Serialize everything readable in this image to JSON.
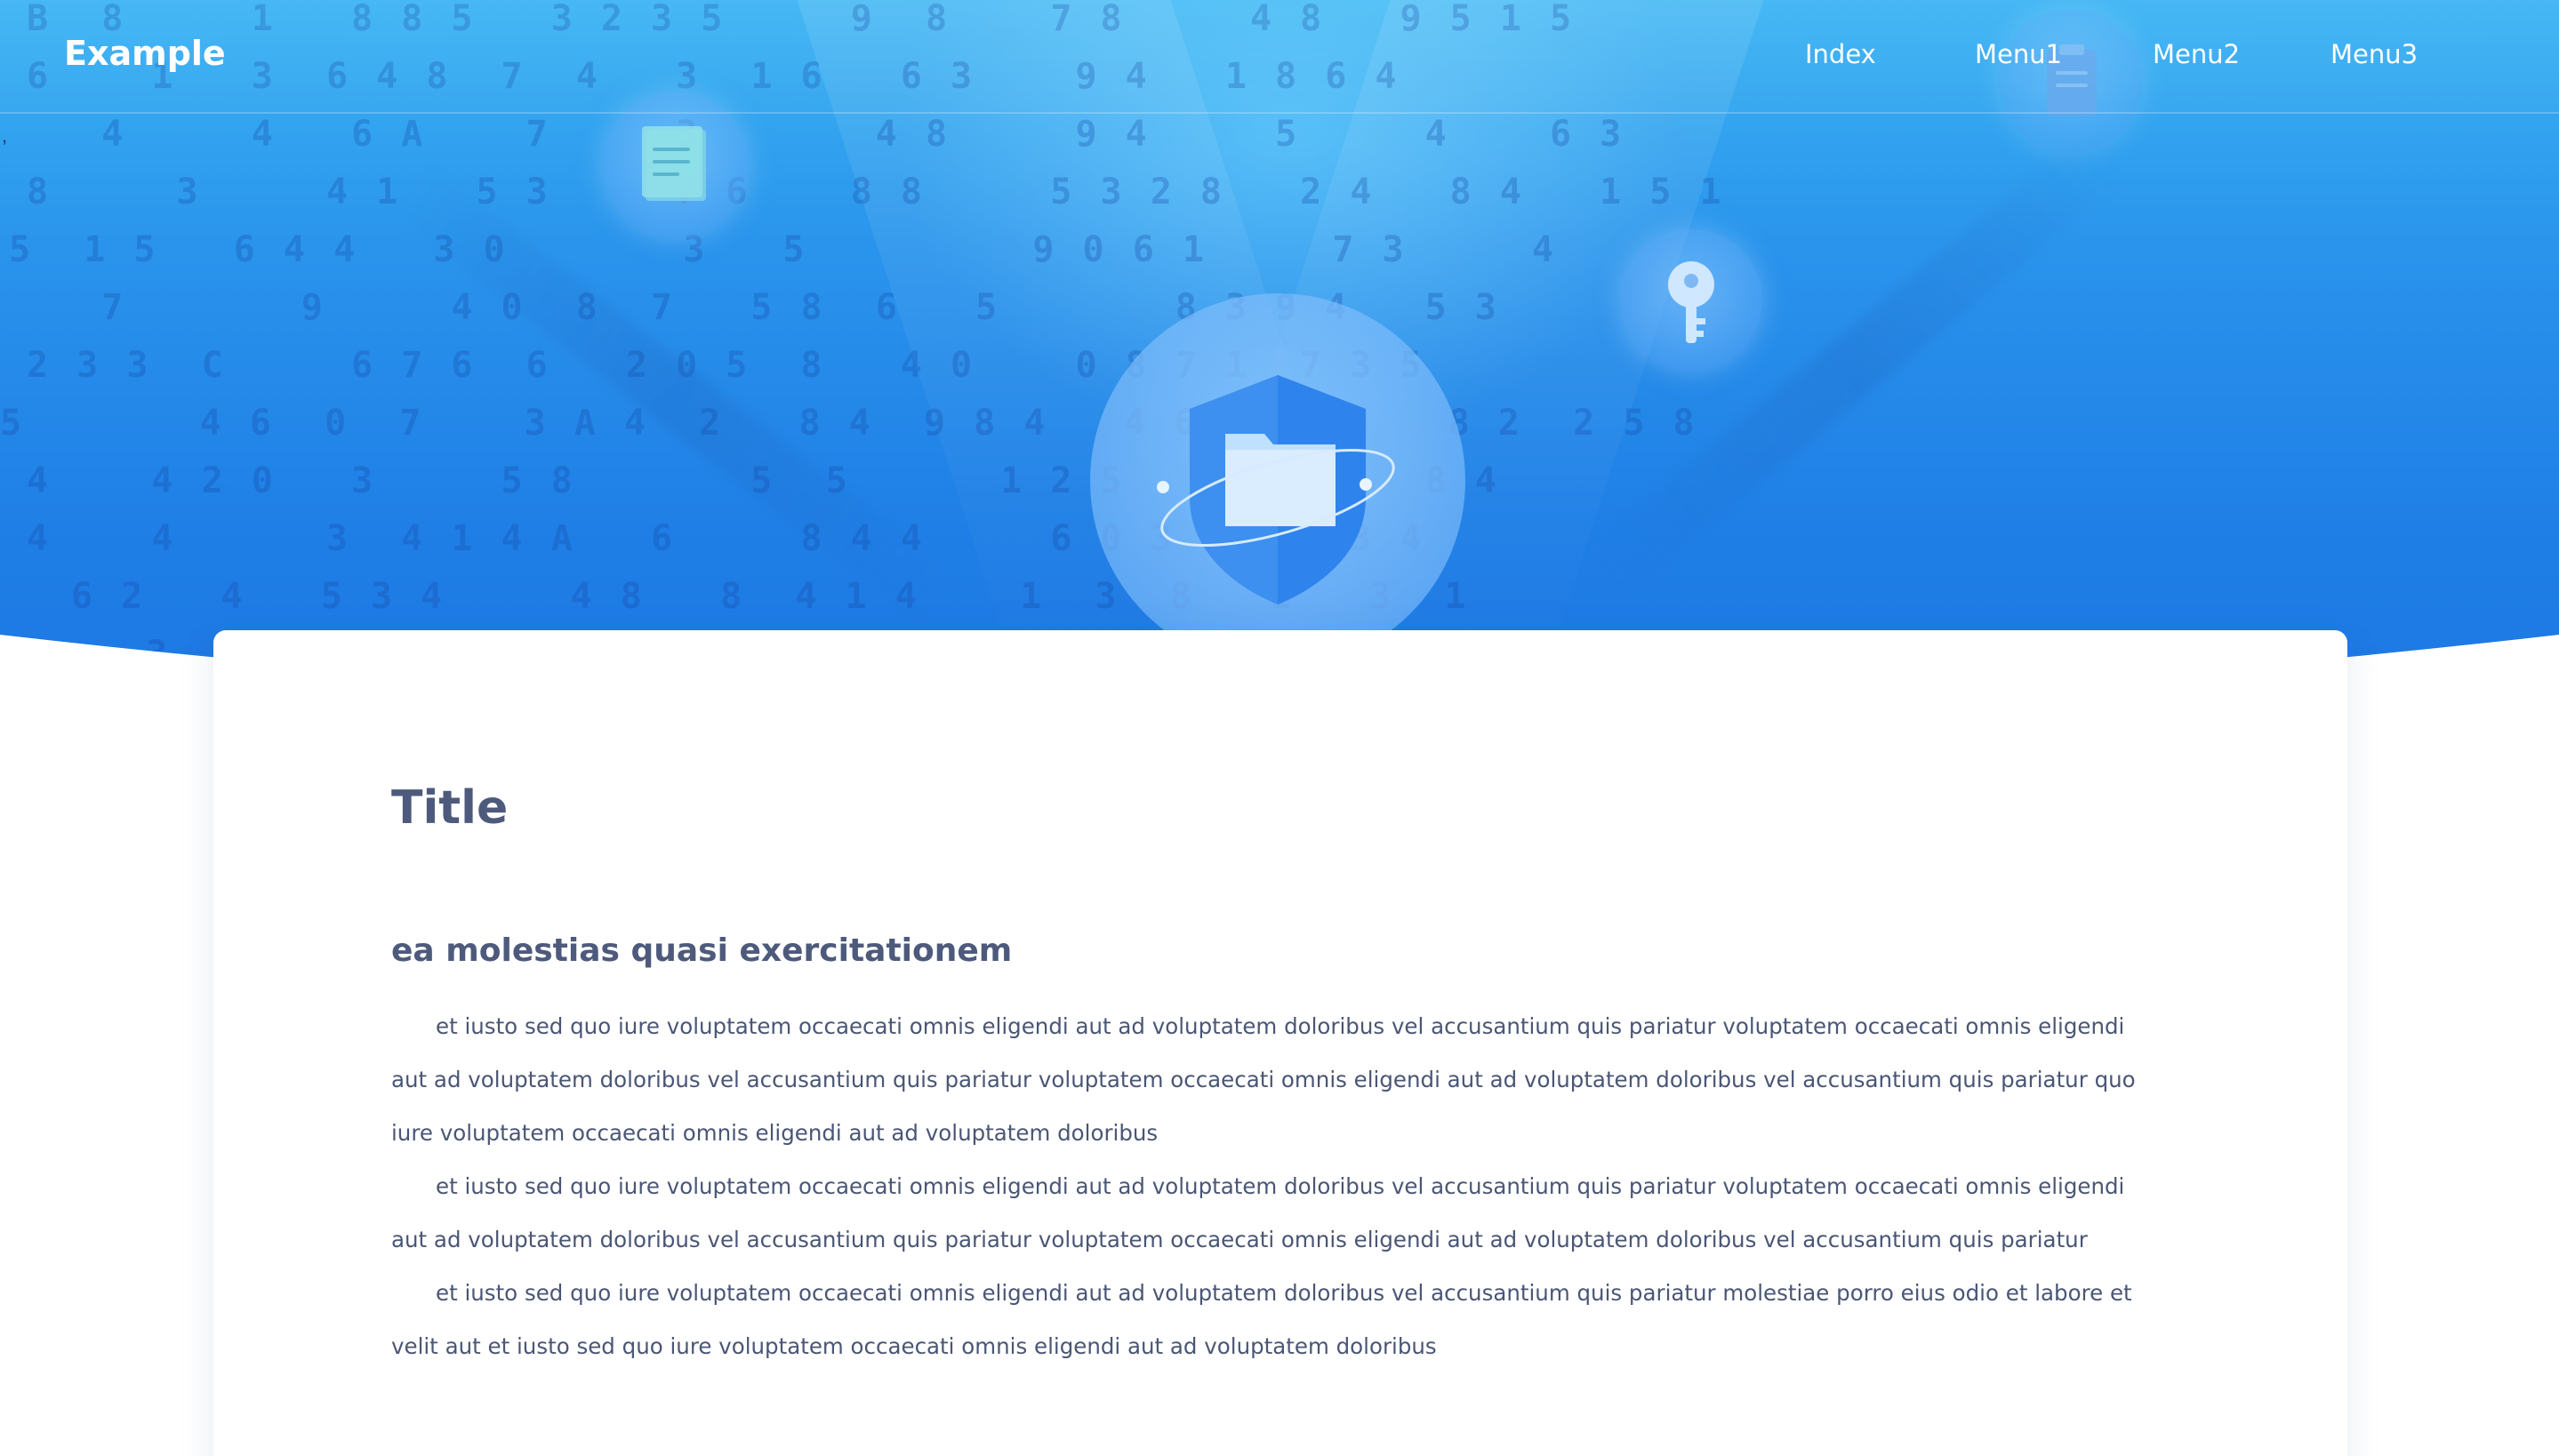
{
  "app": {
    "brand": "Example",
    "nav": [
      {
        "label": "Index"
      },
      {
        "label": "Menu1"
      },
      {
        "label": "Menu2"
      },
      {
        "label": "Menu3"
      }
    ],
    "stray_mark": ","
  },
  "hero": {
    "icons": [
      "document-icon",
      "key-icon",
      "clipboard-icon",
      "shield-folder-icon"
    ],
    "colors": {
      "top": "#3bb4f3",
      "bottom": "#1e77e4"
    }
  },
  "content": {
    "title": "Title",
    "subtitle": "ea molestias quasi exercitationem",
    "paragraphs": [
      "et iusto sed quo iure voluptatem occaecati omnis eligendi aut ad voluptatem doloribus vel accusantium quis pariatur voluptatem occaecati omnis eligendi aut ad voluptatem doloribus vel accusantium quis pariatur voluptatem occaecati omnis eligendi aut ad voluptatem doloribus vel accusantium quis pariatur quo iure voluptatem occaecati omnis eligendi aut ad voluptatem doloribus",
      "et iusto sed quo iure voluptatem occaecati omnis eligendi aut ad voluptatem doloribus vel accusantium quis pariatur voluptatem occaecati omnis eligendi aut ad voluptatem doloribus vel accusantium quis pariatur voluptatem occaecati omnis eligendi aut ad voluptatem doloribus vel accusantium quis pariatur",
      "et iusto sed quo iure voluptatem occaecati omnis eligendi aut ad voluptatem doloribus vel accusantium quis pariatur molestiae porro eius odio et labore et velit aut et iusto sed quo iure voluptatem occaecati omnis eligendi aut ad voluptatem doloribus"
    ]
  }
}
